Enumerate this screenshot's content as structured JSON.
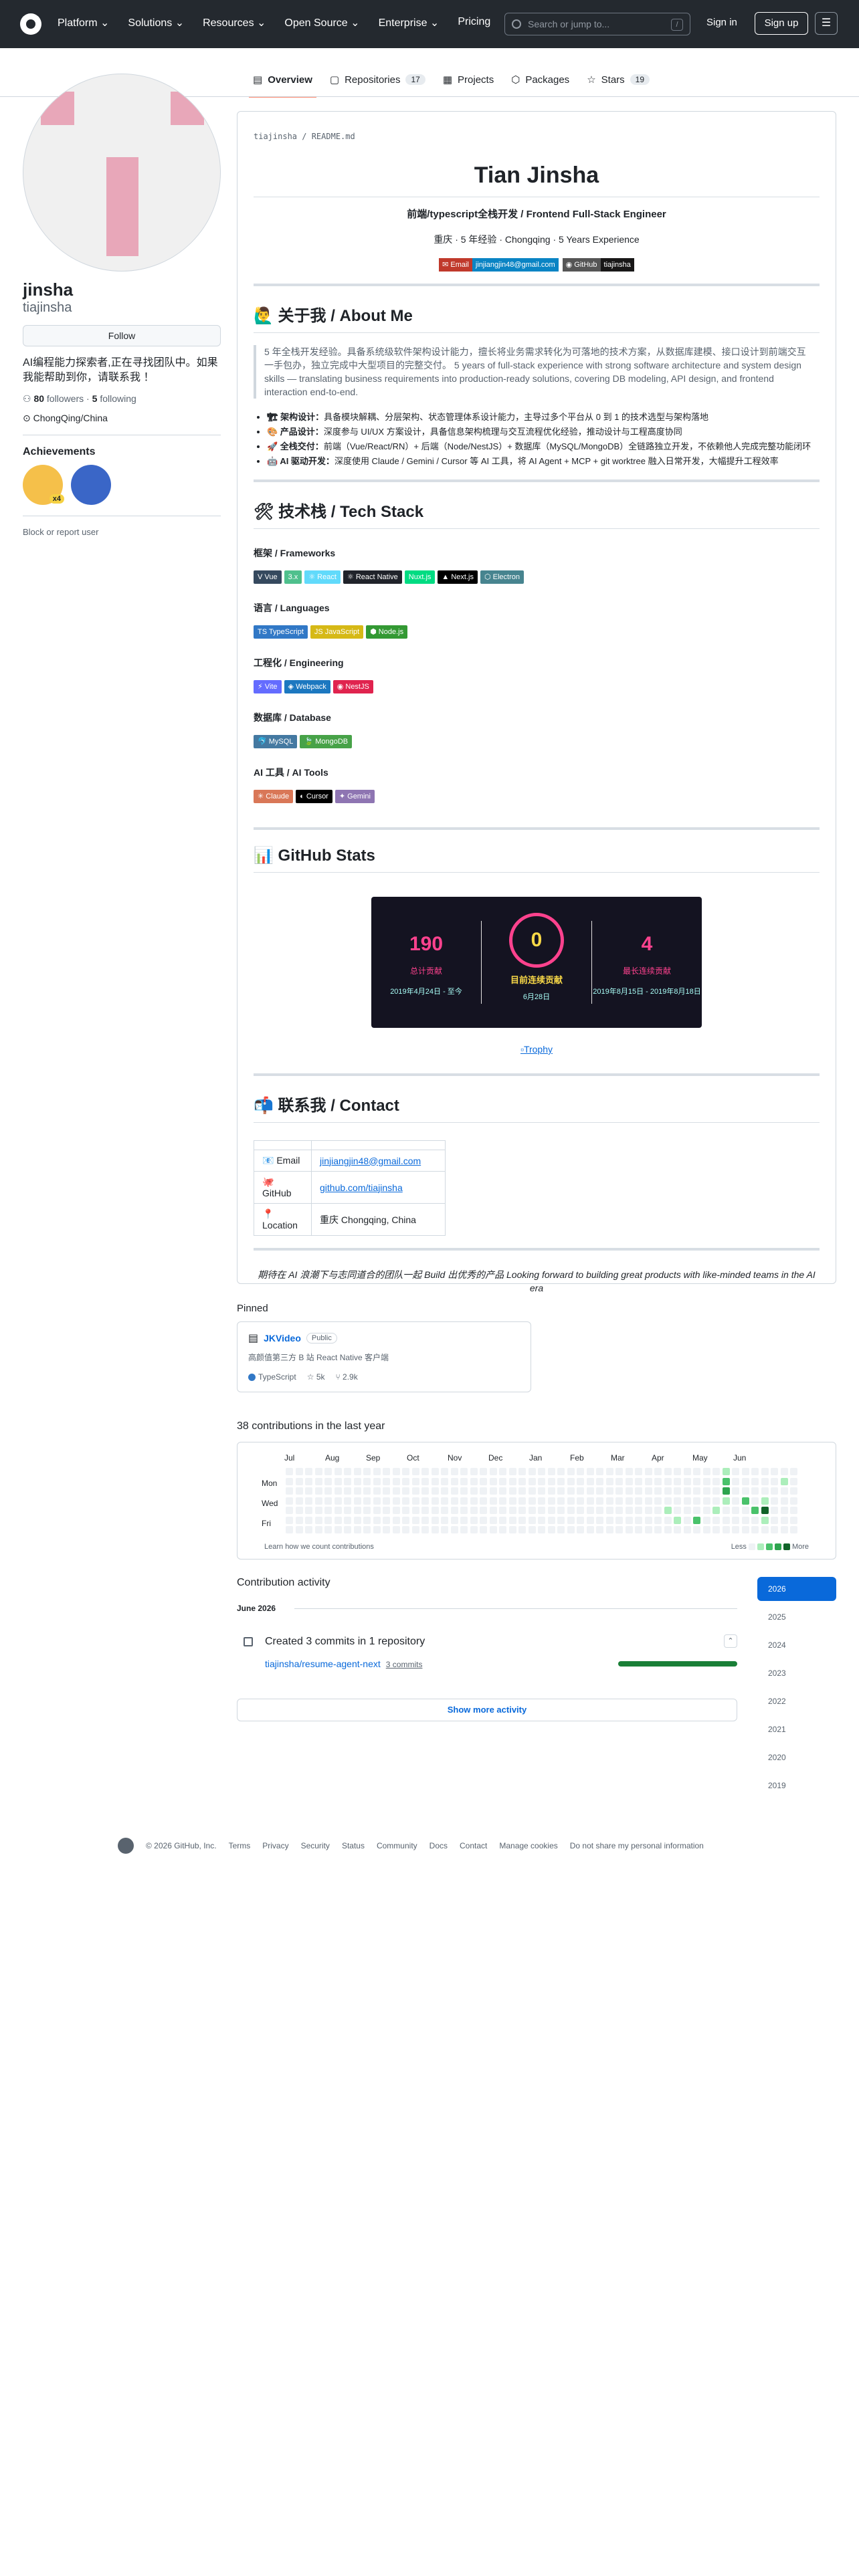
{
  "header": {
    "nav": [
      "Platform ⌄",
      "Solutions ⌄",
      "Resources ⌄",
      "Open Source ⌄",
      "Enterprise ⌄",
      "Pricing"
    ],
    "search_placeholder": "Search or jump to...",
    "search_key": "/",
    "signin": "Sign in",
    "signup": "Sign up"
  },
  "tabs": [
    {
      "label": "Overview",
      "count": ""
    },
    {
      "label": "Repositories",
      "count": "17"
    },
    {
      "label": "Projects",
      "count": ""
    },
    {
      "label": "Packages",
      "count": ""
    },
    {
      "label": "Stars",
      "count": "19"
    }
  ],
  "profile": {
    "name": "jinsha",
    "login": "tiajinsha",
    "follow": "Follow",
    "bio": "AI编程能力探索者,正在寻找团队中。如果我能帮助到你，请联系我 ！",
    "followers": "80",
    "followers_label": "followers",
    "following": "5",
    "following_label": "following",
    "location": "ChongQing/China",
    "achievements_title": "Achievements",
    "achievement_count": "x4",
    "block": "Block or report user"
  },
  "readme": {
    "path": "tiajinsha / README.md",
    "title": "Tian Jinsha",
    "subtitle": "前端/typescript全栈开发 / Frontend Full-Stack Engineer",
    "meta": "重庆 · 5 年经验 · Chongqing · 5 Years Experience",
    "shield_email_l": "✉ Email",
    "shield_email_r": "jinjiangjin48@gmail.com",
    "shield_gh_l": "◉ GitHub",
    "shield_gh_r": "tiajinsha",
    "about_title": "🙋‍♂️ 关于我 / About Me",
    "about_quote": "5 年全栈开发经验。具备系统级软件架构设计能力，擅长将业务需求转化为可落地的技术方案，从数据库建模、接口设计到前端交互一手包办，独立完成中大型项目的完整交付。 5 years of full-stack experience with strong software architecture and system design skills — translating business requirements into production-ready solutions, covering DB modeling, API design, and frontend interaction end-to-end.",
    "about_items": [
      {
        "head": "🏗 架构设计：",
        "text": "具备模块解耦、分层架构、状态管理体系设计能力，主导过多个平台从 0 到 1 的技术选型与架构落地"
      },
      {
        "head": "🎨 产品设计：",
        "text": "深度参与 UI/UX 方案设计，具备信息架构梳理与交互流程优化经验，推动设计与工程高度协同"
      },
      {
        "head": "🚀 全栈交付：",
        "text": "前端（Vue/React/RN）+ 后端（Node/NestJS）+ 数据库（MySQL/MongoDB）全链路独立开发，不依赖他人完成完整功能闭环"
      },
      {
        "head": "🤖 AI 驱动开发：",
        "text": "深度使用 Claude / Gemini / Cursor 等 AI 工具，将 AI Agent + MCP + git worktree 融入日常开发，大幅提升工程效率"
      }
    ],
    "tech_title": "🛠 技术栈 / Tech Stack",
    "groups": [
      {
        "title": "框架 / Frameworks",
        "chips": [
          {
            "label": "V Vue",
            "color": "#35495e"
          },
          {
            "label": "3.x",
            "color": "#4fc08d"
          },
          {
            "label": "⚛ React",
            "color": "#61dafb"
          },
          {
            "label": "⚛ React Native",
            "color": "#20232a"
          },
          {
            "label": "Nuxt.js",
            "color": "#00dc82"
          },
          {
            "label": "▲ Next.js",
            "color": "#000000"
          },
          {
            "label": "⬡ Electron",
            "color": "#47848f"
          }
        ]
      },
      {
        "title": "语言 / Languages",
        "chips": [
          {
            "label": "TS TypeScript",
            "color": "#3178c6"
          },
          {
            "label": "JS JavaScript",
            "color": "#d6b916"
          },
          {
            "label": "⬢ Node.js",
            "color": "#339933"
          }
        ]
      },
      {
        "title": "工程化 / Engineering",
        "chips": [
          {
            "label": "⚡ Vite",
            "color": "#646cff"
          },
          {
            "label": "◈ Webpack",
            "color": "#1c78c0"
          },
          {
            "label": "◉ NestJS",
            "color": "#e0234e"
          }
        ]
      },
      {
        "title": "数据库 / Database",
        "chips": [
          {
            "label": "🐬 MySQL",
            "color": "#4479a1"
          },
          {
            "label": "🍃 MongoDB",
            "color": "#47a248"
          }
        ]
      },
      {
        "title": "AI 工具 / AI Tools",
        "chips": [
          {
            "label": "✳ Claude",
            "color": "#d97757"
          },
          {
            "label": "◐ Cursor",
            "color": "#000000"
          },
          {
            "label": "✦ Gemini",
            "color": "#8e75b2"
          }
        ]
      }
    ],
    "stats_title": "📊 GitHub Stats",
    "stats": {
      "total": "190",
      "total_label": "总计贡献",
      "total_range": "2019年4月24日 - 至今",
      "current": "0",
      "current_label": "目前连续贡献",
      "current_range": "6月28日",
      "longest": "4",
      "longest_label": "最长连续贡献",
      "longest_range": "2019年8月15日 - 2019年8月18日"
    },
    "trophy": "Trophy",
    "contact_title": "📬 联系我 / Contact",
    "contacts": [
      {
        "label": "📧 Email",
        "value": "jinjiangjin48@gmail.com"
      },
      {
        "label": "🐙 GitHub",
        "value": "github.com/tiajinsha"
      },
      {
        "label": "📍 Location",
        "value": "重庆 Chongqing, China"
      }
    ],
    "closing": "期待在 AI 浪潮下与志同道合的团队一起 Build 出优秀的产品 Looking forward to building great products with like-minded teams in the AI era"
  },
  "pinned": {
    "title": "Pinned",
    "repo": "JKVideo",
    "visibility": "Public",
    "desc": "高颜值第三方 B 站 React Native 客户端",
    "lang": "TypeScript",
    "stars": "5k",
    "forks": "2.9k"
  },
  "contrib": {
    "title": "38 contributions in the last year",
    "months": [
      "Jul",
      "Aug",
      "Sep",
      "Oct",
      "Nov",
      "Dec",
      "Jan",
      "Feb",
      "Mar",
      "Apr",
      "May",
      "Jun"
    ],
    "days": [
      "Mon",
      "Wed",
      "Fri"
    ],
    "learn": "Learn how we count contributions",
    "less": "Less",
    "more": "More"
  },
  "activity": {
    "title": "Contribution activity",
    "month": "June 2026",
    "item": "Created 3 commits in 1 repository",
    "repo": "tiajinsha/resume-agent-next",
    "commits": "3 commits",
    "show_more": "Show more activity",
    "years": [
      "2026",
      "2025",
      "2024",
      "2023",
      "2022",
      "2021",
      "2020",
      "2019"
    ]
  },
  "footer": {
    "copyright": "© 2026 GitHub, Inc.",
    "links": [
      "Terms",
      "Privacy",
      "Security",
      "Status",
      "Community",
      "Docs",
      "Contact",
      "Manage cookies",
      "Do not share my personal information"
    ]
  }
}
